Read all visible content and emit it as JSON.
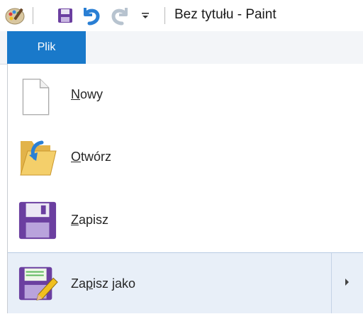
{
  "window": {
    "title": "Bez tytułu - Paint"
  },
  "quick_access": {
    "icons": [
      "paint-app-icon",
      "save-icon",
      "undo-icon",
      "redo-icon",
      "customize-dropdown-icon"
    ]
  },
  "ribbon": {
    "file_tab_label": "Plik"
  },
  "file_menu": {
    "items": [
      {
        "label": "Nowy",
        "mnemonic": "N",
        "rest": "owy",
        "icon": "new-document-icon"
      },
      {
        "label": "Otwórz",
        "mnemonic": "O",
        "rest": "twórz",
        "icon": "open-folder-icon"
      },
      {
        "label": "Zapisz",
        "mnemonic": "Z",
        "rest": "apisz",
        "icon": "save-floppy-icon"
      },
      {
        "label": "Zapisz jako",
        "pre": "Za",
        "mnemonic": "p",
        "rest": "isz jako",
        "icon": "save-as-icon"
      }
    ]
  },
  "colors": {
    "accent": "#1979ca",
    "hover": "#e8eff8"
  }
}
